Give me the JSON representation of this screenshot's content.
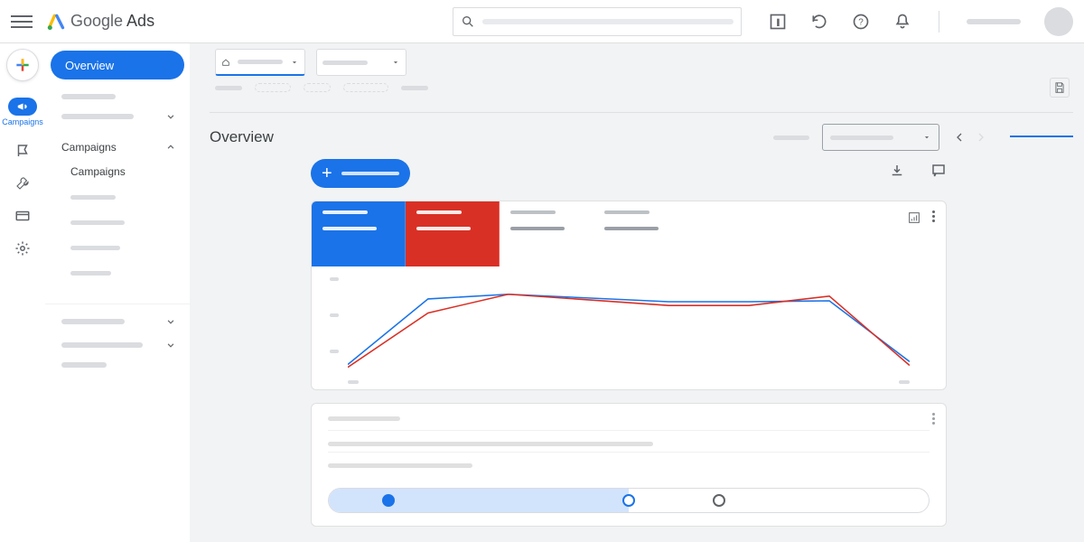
{
  "header": {
    "brand_light": "Google",
    "brand_bold": " Ads"
  },
  "leftrail": {
    "campaigns_label": "Campaigns"
  },
  "sidenav": {
    "overview_label": "Overview",
    "campaigns_label": "Campaigns",
    "campaigns_sub_label": "Campaigns"
  },
  "overview": {
    "title": "Overview"
  },
  "chart_data": {
    "type": "line",
    "x": [
      0,
      1,
      2,
      3,
      4,
      5,
      6,
      7
    ],
    "series": [
      {
        "name": "blue",
        "color": "#1a73e8",
        "values": [
          5,
          75,
          80,
          76,
          72,
          72,
          73,
          8
        ]
      },
      {
        "name": "red",
        "color": "#d93025",
        "values": [
          2,
          60,
          80,
          74,
          68,
          68,
          78,
          4
        ]
      }
    ],
    "ylim": [
      0,
      100
    ]
  },
  "steps": [
    {
      "state": "solid"
    },
    {
      "state": "ring-blue"
    },
    {
      "state": "ring-gray"
    }
  ]
}
